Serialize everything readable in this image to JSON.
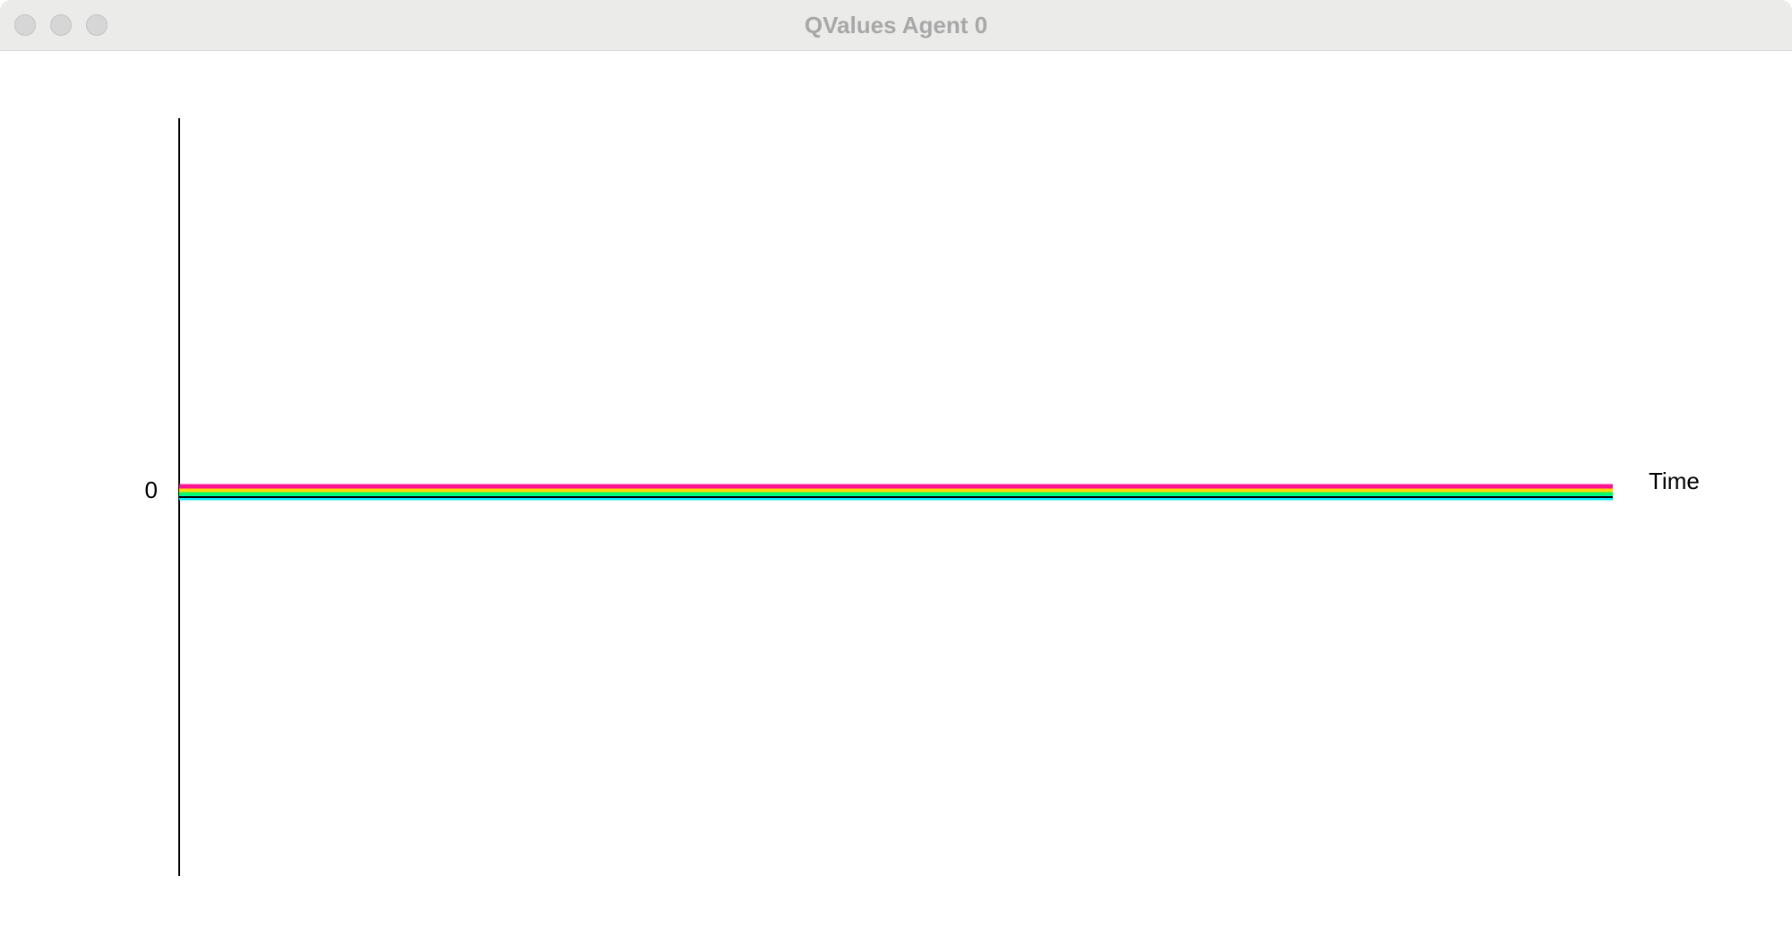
{
  "window": {
    "title": "QValues Agent 0",
    "controls": {
      "close_icon": "close-icon",
      "minimize_icon": "minimize-icon",
      "zoom_icon": "zoom-icon"
    }
  },
  "chart_data": {
    "type": "line",
    "title": "",
    "xlabel": "Time",
    "ylabel": "",
    "y_ticks": [
      "0"
    ],
    "grid": false,
    "legend": "none",
    "series": [
      {
        "color": "#ff1493",
        "values": [
          0,
          0
        ]
      },
      {
        "color": "#ffd700",
        "values": [
          0,
          0
        ]
      },
      {
        "color": "#00ff66",
        "values": [
          0,
          0
        ]
      },
      {
        "color": "#00e5ff",
        "values": [
          0,
          0
        ]
      }
    ],
    "series_offsets_note": ""
  }
}
